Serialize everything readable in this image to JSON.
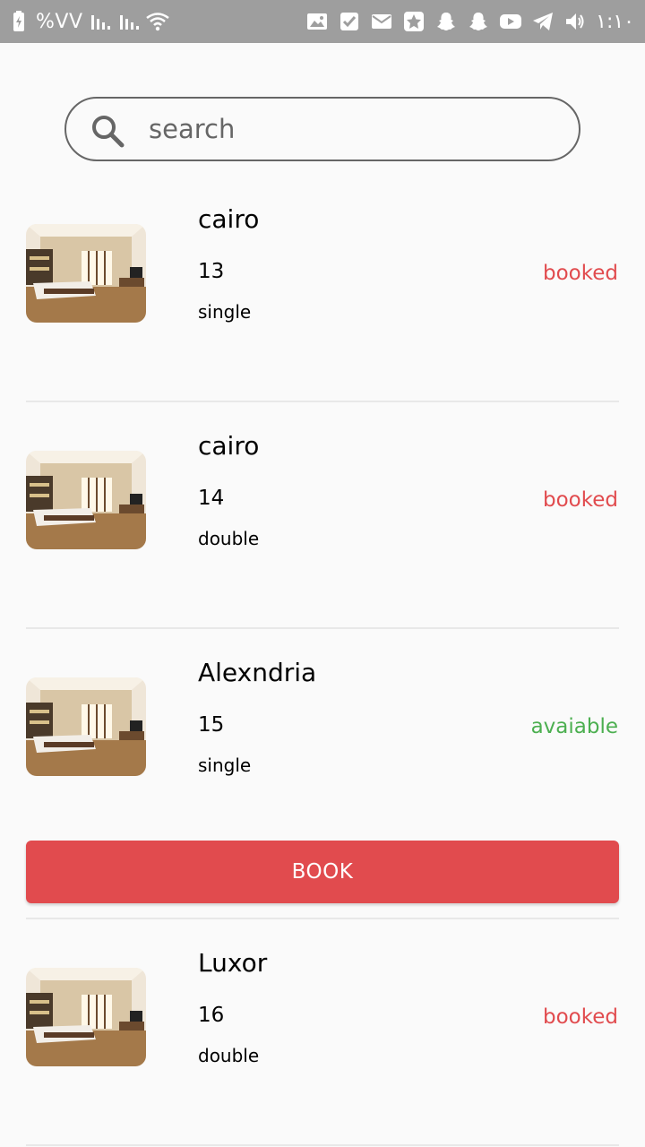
{
  "statusbar": {
    "battery_text": "%VV",
    "time": "١:١٠",
    "icons": [
      "battery-charging-icon",
      "signal-icon",
      "signal-icon",
      "wifi-icon",
      "image-icon",
      "checkbox-icon",
      "mail-icon",
      "star-app-icon",
      "snapchat-icon",
      "snapchat-icon",
      "youtube-icon",
      "telegram-icon",
      "volume-icon"
    ]
  },
  "search": {
    "placeholder": "search"
  },
  "rooms": [
    {
      "city": "cairo",
      "number": "13",
      "type": "single",
      "status": "booked"
    },
    {
      "city": "cairo",
      "number": "14",
      "type": "double",
      "status": "booked"
    },
    {
      "city": "Alexndria",
      "number": "15",
      "type": "single",
      "status": "avaiable"
    },
    {
      "city": "Luxor",
      "number": "16",
      "type": "double",
      "status": "booked"
    }
  ],
  "book_button": {
    "label": "BOOK"
  },
  "colors": {
    "booked": "#e14b4e",
    "available": "#4caf50",
    "button": "#e14b4e",
    "statusbar": "#9e9e9e"
  }
}
